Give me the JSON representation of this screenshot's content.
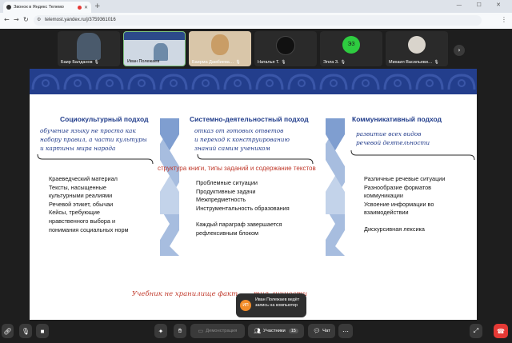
{
  "browser": {
    "tab_title": "Звонок в Яндекс Телемо",
    "new_tab": "+",
    "window_controls": "— ☐ ✕",
    "url": "telemost.yandex.ru/j/3759361016"
  },
  "participants": [
    {
      "name": "Баир Балданов",
      "kind": "video",
      "photo_color": "#3b4a5c"
    },
    {
      "name": "Иван Полежаев",
      "kind": "video",
      "photo_color": "#6d8aa8",
      "active": true
    },
    {
      "name": "Баирма Дамбиева…",
      "kind": "video",
      "photo_color": "#c9a36a"
    },
    {
      "name": "Наталья Т.",
      "kind": "avatar",
      "avatar_color": "#222222",
      "initials": ""
    },
    {
      "name": "Элла З.",
      "kind": "avatar",
      "avatar_color": "#2ecc40",
      "initials": "ЭЗ"
    },
    {
      "name": "Михаил Васильеви…",
      "kind": "avatar",
      "avatar_color": "#d9d4cc",
      "initials": ""
    }
  ],
  "slide": {
    "columns": [
      {
        "title": "Социокультурный подход",
        "subtitle": [
          "обучение языку не просто как",
          "набору правил, а части культуры",
          "и картины мира народа"
        ],
        "items": [
          "Краеведческий материал",
          "Тексты, насыщенные",
          "культурными реалиями",
          "Речевой этикет, обычаи",
          "Кейсы, требующие",
          "нравственного выбора и",
          "понимания социальных норм"
        ]
      },
      {
        "title": "Системно-деятельностный подход",
        "subtitle": [
          "отказ от готовых ответов",
          "и переход к конструированию",
          "знаний самим учеником"
        ],
        "items": [
          "Проблемные ситуации",
          "Продуктивные задачи",
          "Межпредметность",
          "Инструментальность образования"
        ],
        "items2": [
          "Каждый параграф завершается",
          "рефлексивным блоком"
        ]
      },
      {
        "title": "Коммуникативный подход",
        "subtitle": [
          "развитие всех видов",
          "речевой деятельности"
        ],
        "items": [
          "Различные речевые ситуации",
          "Разнообразие форматов",
          "коммуникации",
          "Усвоение информации во",
          "взаимодействии"
        ],
        "items2": [
          "Дискурсивная лексика"
        ]
      }
    ],
    "center_line": "структура книги, типы заданий и содержание текстов",
    "bottom_line": "Учебник не хранилище факт…                              …тия личности",
    "accent": "#1f3b8a",
    "red": "#c0392b"
  },
  "toast": {
    "initials": "ИП",
    "message": "Иван Полежаев ведёт запись на компьютер"
  },
  "toolbar": {
    "demo_label": "Демонстрация",
    "participants_label": "Участники",
    "participants_count": "15",
    "chat_label": "Чат"
  }
}
